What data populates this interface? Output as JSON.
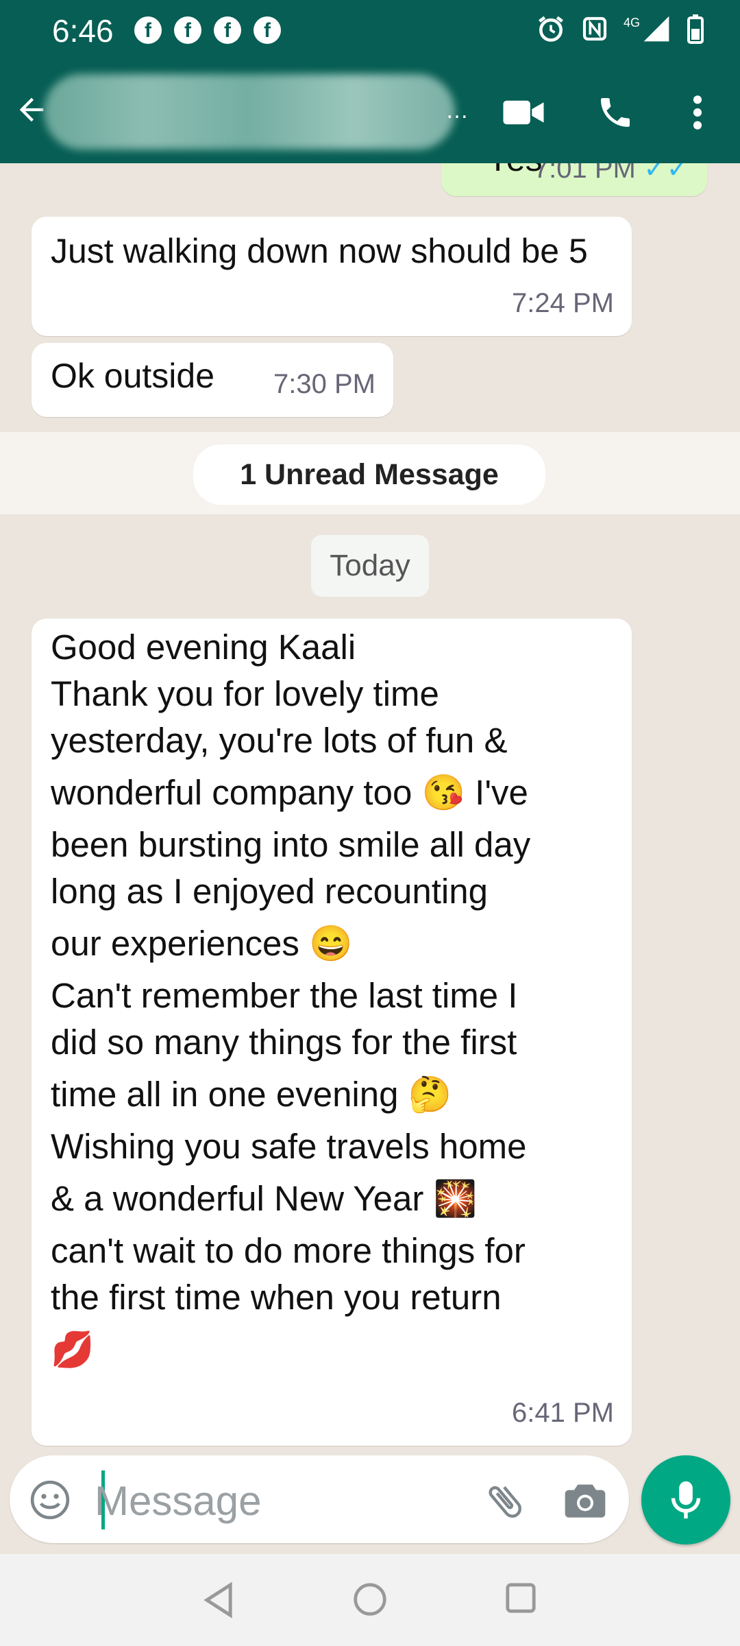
{
  "status_bar": {
    "time": "6:46",
    "network": "4G",
    "notification_icons": [
      "facebook-icon",
      "facebook-icon",
      "facebook-icon",
      "facebook-icon"
    ],
    "system_icons": [
      "alarm-icon",
      "nfc-icon",
      "signal-icon",
      "battery-icon"
    ]
  },
  "app_bar": {
    "contact_name_blurred": true,
    "actions": [
      "video-call-icon",
      "voice-call-icon",
      "more-options-icon"
    ]
  },
  "messages": [
    {
      "direction": "outgoing",
      "text": "Yes",
      "time": "7:01 PM",
      "status": "read"
    },
    {
      "direction": "incoming",
      "text": "Just walking down now should be 5",
      "time": "7:24 PM"
    },
    {
      "direction": "incoming",
      "text": "Ok outside",
      "time": "7:30 PM"
    },
    {
      "direction": "incoming",
      "text_lines": [
        "Good evening Kaali",
        "Thank you for lovely time",
        "yesterday, you're lots of fun &",
        "wonderful company too 😘 I've",
        "been bursting into smile all day",
        "long as I enjoyed recounting",
        "our experiences 😄",
        "Can't remember the last time I",
        "did so many things for the first",
        "time all in one evening 🤔",
        "Wishing you safe travels home",
        "& a wonderful New Year 🎇",
        "can't wait to do more things for",
        "the first time when you return",
        "💋"
      ],
      "time": "6:41 PM"
    }
  ],
  "unread_label": "1 Unread Message",
  "date_label": "Today",
  "composer": {
    "placeholder": "Message",
    "value": "",
    "icons": [
      "emoji-icon",
      "attach-icon",
      "camera-icon"
    ],
    "send_action": "microphone-icon"
  },
  "colors": {
    "header": "#075E54",
    "accent": "#00A884",
    "outgoing_bubble": "#DCF8C6",
    "incoming_bubble": "#FFFFFF",
    "chat_background": "#ECE5DD",
    "read_ticks": "#34B7F1"
  }
}
